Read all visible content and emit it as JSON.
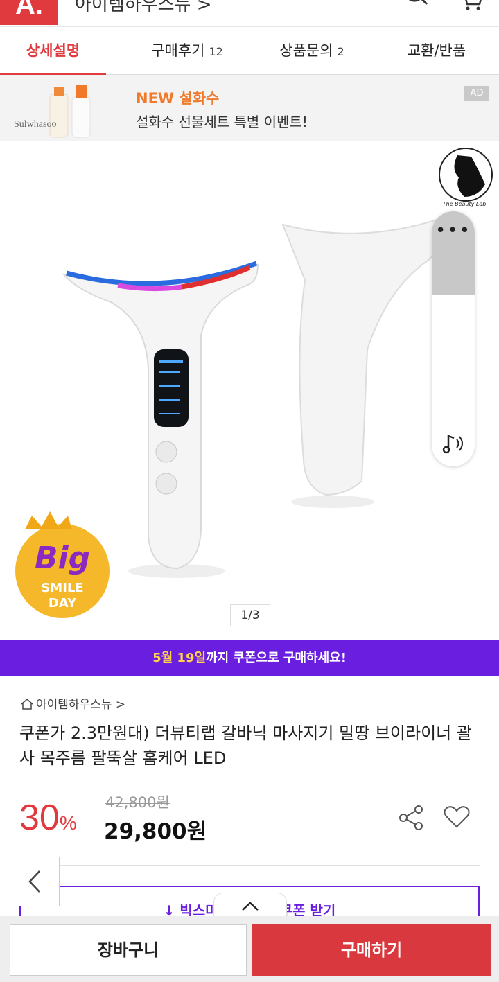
{
  "colors": {
    "accent": "#e03a3e",
    "promo": "#6a1ee0",
    "ad_orange": "#f07a2a",
    "buy": "#d9393e"
  },
  "header": {
    "logo": "A.",
    "store_crumb": "아이템하우스뉴 >",
    "icons": [
      "search-icon",
      "cart-icon"
    ]
  },
  "tabs": [
    {
      "label": "상세설명",
      "count": ""
    },
    {
      "label": "구매후기",
      "count": "12"
    },
    {
      "label": "상품문의",
      "count": "2"
    },
    {
      "label": "교환/반품",
      "count": ""
    }
  ],
  "ad": {
    "brand": "Sulwhasoo",
    "title": "NEW 설화수",
    "subtitle": "설화수 선물세트 특별 이벤트!",
    "badge": "AD"
  },
  "hero": {
    "brand_logo_text": "The Beauty Lab",
    "badge": {
      "big": "Big",
      "smile": "SMILE",
      "day": "DAY"
    },
    "page_counter": "1/3",
    "float_panel": {
      "more": "•••",
      "icon": "sound-icon"
    }
  },
  "promo": {
    "date": "5월 19일",
    "text": "까지 쿠폰으로 구매하세요!"
  },
  "product": {
    "store": "아이템하우스뉴 >",
    "title": "쿠폰가 2.3만원대) 더뷰티랩 갈바닉 마사지기 밀땅 브이라이너 괄사 목주름 팔뚝살 홈케어 LED",
    "discount_value": "30",
    "discount_unit": "%",
    "original_price": "42,800원",
    "sale_price": "29,800원"
  },
  "coupon": {
    "text": "↓ 빅스마일데이 % 쿠폰 받기"
  },
  "bottom": {
    "cart_label": "장바구니",
    "buy_label": "구매하기"
  }
}
